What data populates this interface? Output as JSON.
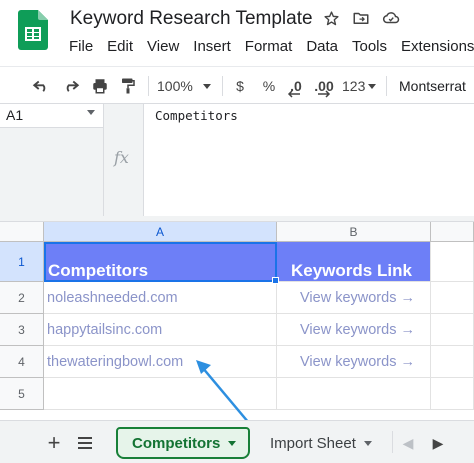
{
  "app": {
    "doc_title": "Keyword Research Template",
    "icons": [
      "star-icon",
      "move-to-folder-icon",
      "cloud-status-icon"
    ]
  },
  "menu": [
    "File",
    "Edit",
    "View",
    "Insert",
    "Format",
    "Data",
    "Tools",
    "Extensions"
  ],
  "toolbar": {
    "zoom": "100%",
    "currency": "$",
    "percent": "%",
    "dec_decrease": ".0",
    "dec_increase": ".00",
    "number_format": "123",
    "font": "Montserrat"
  },
  "formula_bar": {
    "cell_ref": "A1",
    "fx": "fx",
    "content": "Competitors"
  },
  "grid": {
    "columns": [
      "A",
      "B"
    ],
    "rows": [
      "1",
      "2",
      "3",
      "4",
      "5"
    ],
    "header": [
      "Competitors",
      "Keywords Link"
    ],
    "data": [
      [
        "noleashneeded.com",
        "View keywords →"
      ],
      [
        "happytailsinc.com",
        "View keywords →"
      ],
      [
        "thewateringbowl.com",
        "View keywords →"
      ]
    ],
    "header_color": "#6d7ff7",
    "link_color": "#8b94c9"
  },
  "sheets": {
    "active": "Competitors",
    "other": "Import Sheet",
    "active_color": "#188038"
  }
}
